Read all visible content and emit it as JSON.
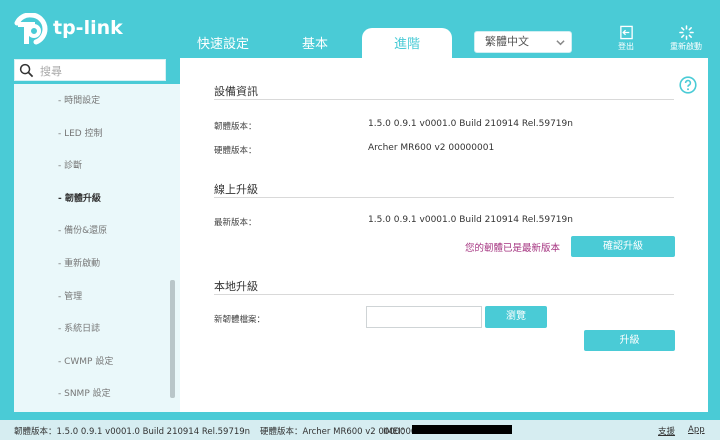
{
  "header": {
    "logo_text": "tp-link",
    "tabs": [
      "快速設定",
      "基本",
      "進階"
    ],
    "language": "繁體中文",
    "logout_label": "登出",
    "reboot_label": "重新啟動"
  },
  "sidebar": {
    "search_placeholder": "搜尋",
    "items": [
      "- 時間設定",
      "- LED 控制",
      "- 診斷",
      "- 韌體升級",
      "- 備份&還原",
      "- 重新啟動",
      "- 管理",
      "- 系統日誌",
      "- CWMP 設定",
      "- SNMP 設定"
    ],
    "active_index": 3
  },
  "main": {
    "device_info": {
      "title": "設備資訊",
      "firmware_label": "韌體版本：",
      "firmware_value": "1.5.0 0.9.1 v0001.0 Build 210914 Rel.59719n",
      "hardware_label": "硬體版本：",
      "hardware_value": "Archer MR600 v2 00000001"
    },
    "online_upgrade": {
      "title": "線上升級",
      "latest_label": "最新版本：",
      "latest_value": "1.5.0 0.9.1 v0001.0 Build 210914 Rel.59719n",
      "status_message": "您的韌體已是最新版本",
      "check_button": "確認升級"
    },
    "local_upgrade": {
      "title": "本地升級",
      "file_label": "新韌體檔案：",
      "file_value": "",
      "browse_button": "瀏覽",
      "upgrade_button": "升級"
    }
  },
  "footer": {
    "firmware": "韌體版本：1.5.0 0.9.1 v0001.0 Build 210914 Rel.59719n",
    "hardware": "硬體版本：Archer MR600 v2 00000001",
    "imei_label": "IMEI：",
    "support": "支援",
    "app": "App"
  },
  "colors": {
    "accent": "#4acbd6",
    "status": "#a53480"
  }
}
